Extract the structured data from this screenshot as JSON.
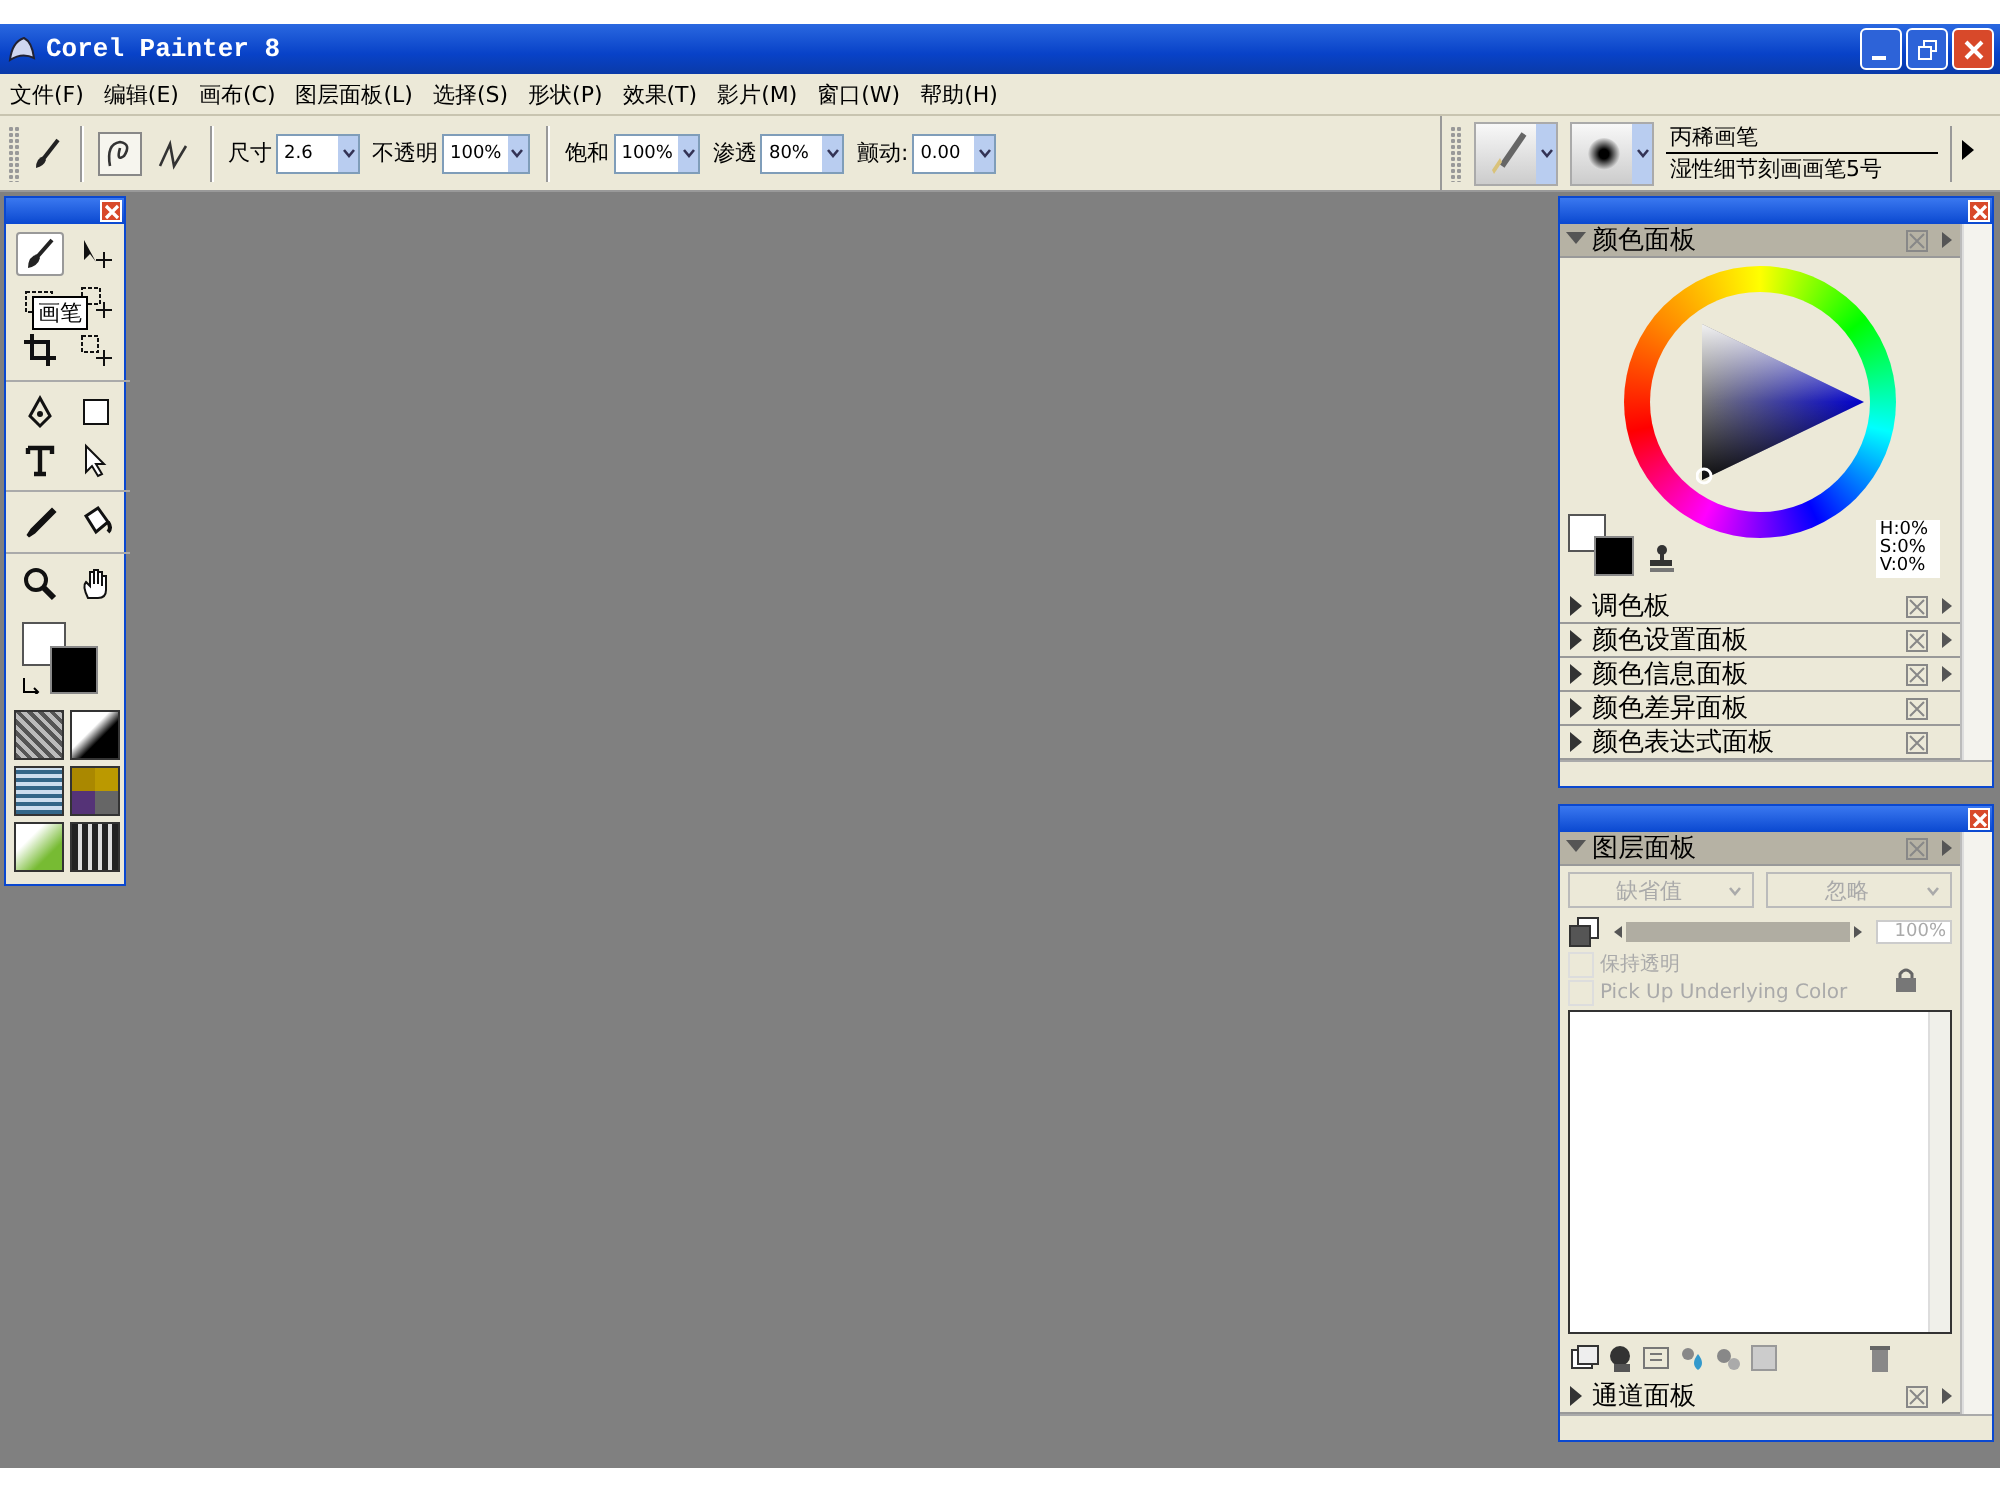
{
  "window": {
    "title": "Corel Painter 8"
  },
  "menu": [
    "文件(F)",
    "编辑(E)",
    "画布(C)",
    "图层面板(L)",
    "选择(S)",
    "形状(P)",
    "效果(T)",
    "影片(M)",
    "窗口(W)",
    "帮助(H)"
  ],
  "property_bar": {
    "fields": [
      {
        "label": "尺寸",
        "value": "2.6"
      },
      {
        "label": "不透明",
        "value": "100%"
      },
      {
        "label": "饱和",
        "value": "100%"
      },
      {
        "label": "渗透",
        "value": "80%"
      },
      {
        "label": "颤动:",
        "value": "0.00"
      }
    ]
  },
  "brush_selector": {
    "category": "丙稀画笔",
    "variant": "湿性细节刻画画笔5号"
  },
  "toolbox": {
    "tooltip": "画笔",
    "tools": [
      {
        "kind": "brush",
        "selected": true
      },
      {
        "kind": "move",
        "selected": false
      },
      {
        "kind": "rect-select",
        "selected": false
      },
      {
        "kind": "lasso",
        "selected": false
      },
      {
        "kind": "crop",
        "selected": false
      },
      {
        "kind": "layer-adjuster",
        "selected": false
      },
      {
        "kind": "pen",
        "selected": false
      },
      {
        "kind": "rectangle",
        "selected": false
      },
      {
        "kind": "text",
        "selected": false
      },
      {
        "kind": "arrow",
        "selected": false
      },
      {
        "kind": "dropper",
        "selected": false
      },
      {
        "kind": "bucket",
        "selected": false
      },
      {
        "kind": "magnifier",
        "selected": false
      },
      {
        "kind": "hand",
        "selected": false
      }
    ]
  },
  "color_palette": {
    "title": "颜色面板",
    "expanded": true,
    "readout": [
      "H:0%",
      "S:0%",
      "V:0%"
    ],
    "sections": [
      {
        "title": "调色板",
        "expanded": false,
        "menu": true
      },
      {
        "title": "颜色设置面板",
        "expanded": false,
        "menu": true
      },
      {
        "title": "颜色信息面板",
        "expanded": false,
        "menu": true
      },
      {
        "title": "颜色差异面板",
        "expanded": false,
        "menu": false
      },
      {
        "title": "颜色表达式面板",
        "expanded": false,
        "menu": false
      }
    ]
  },
  "layers_palette": {
    "title": "图层面板",
    "expanded": true,
    "composite_method": "缺省值",
    "composite_depth": "忽略",
    "opacity": "100%",
    "opacity_slider": {
      "level": 1
    },
    "options": [
      {
        "label": "保持透明",
        "checked": false,
        "disabled": true
      },
      {
        "label": "Pick Up Underlying Color",
        "checked": false,
        "disabled": true
      }
    ],
    "sections": [
      {
        "title": "通道面板",
        "expanded": false,
        "menu": true
      }
    ]
  }
}
